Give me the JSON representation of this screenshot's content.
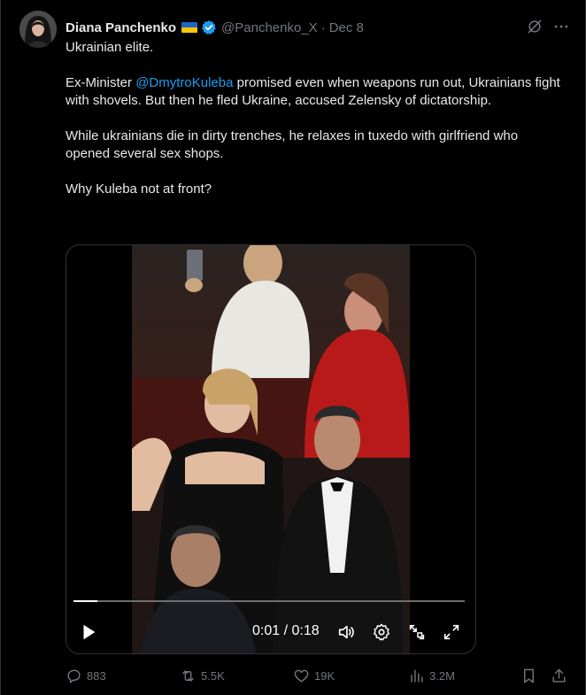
{
  "post": {
    "author_name": "Diana Panchenko",
    "handle": "@Panchenko_X",
    "separator": "·",
    "date": "Dec 8",
    "paragraphs": {
      "p1": "Ukrainian elite.",
      "p2_prefix": "Ex-Minister ",
      "p2_mention": "@DmytroKuleba",
      "p2_suffix": " promised even when weapons run out, Ukrainians fight with shovels. But then he fled Ukraine, accused Zelensky of dictatorship.",
      "p3": "While ukrainians die in dirty trenches, he relaxes in tuxedo with girlfriend who opened several sex shops.",
      "p4": "Why Kuleba not at front?"
    }
  },
  "video": {
    "time_display": "0:01 / 0:18",
    "progress": 0.06
  },
  "actions": {
    "replies": "883",
    "reposts": "5.5K",
    "likes": "19K",
    "views": "3.2M"
  },
  "icons": {
    "verified": "verified-badge-icon",
    "grok": "grok-icon",
    "more": "more-icon",
    "play": "play-icon",
    "volume": "volume-icon",
    "settings": "settings-icon",
    "pip": "picture-in-picture-icon",
    "fullscreen": "fullscreen-icon",
    "reply": "reply-icon",
    "repost": "repost-icon",
    "like": "like-icon",
    "views": "views-icon",
    "bookmark": "bookmark-icon",
    "share": "share-icon"
  },
  "colors": {
    "background": "#000000",
    "text": "#e7e9ea",
    "muted": "#71767b",
    "accent": "#1d9bf0",
    "flag_blue": "#1d66c8",
    "flag_yellow": "#f7c600"
  }
}
